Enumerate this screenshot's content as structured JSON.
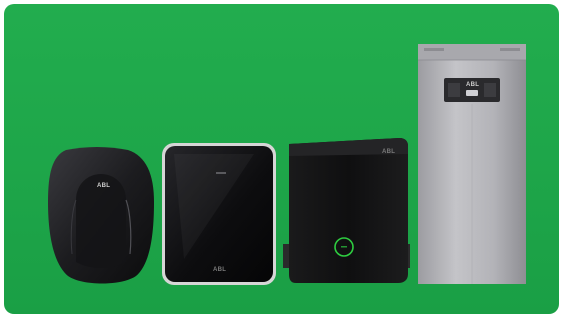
{
  "scene": {
    "background_color": "#1ea84a",
    "products": [
      {
        "name": "wallbox-curved",
        "brand_text": "ABL",
        "color": "#1c1c1f"
      },
      {
        "name": "wallbox-glass",
        "brand_text": "ABL",
        "color": "#0d0d0f",
        "accent": "#d8d8d8"
      },
      {
        "name": "wallbox-ring",
        "brand_text": "ABL",
        "color": "#0f0f10",
        "accent": "#2ecc40"
      },
      {
        "name": "charging-pillar",
        "brand_text": "ABL",
        "color": "#b9b9bd"
      }
    ]
  }
}
